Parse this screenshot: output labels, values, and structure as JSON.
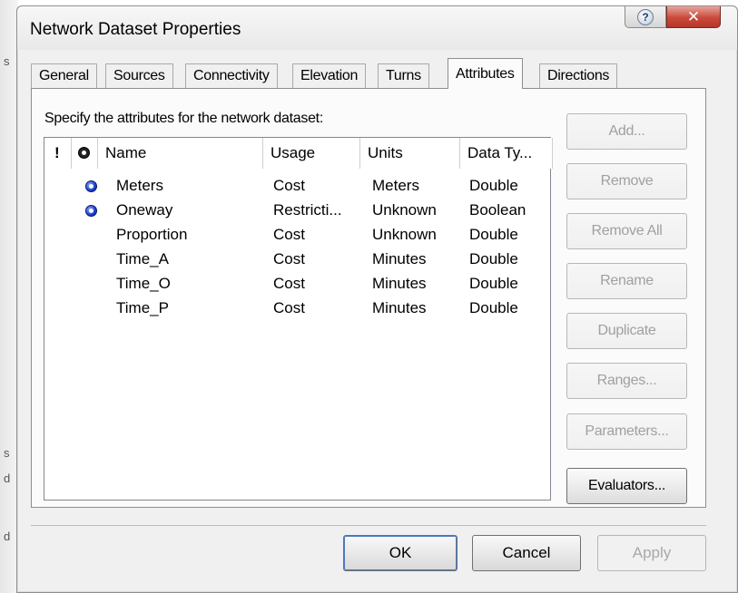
{
  "window": {
    "title": "Network Dataset Properties",
    "help_glyph": "?",
    "close_glyph": "✕"
  },
  "tabs": [
    {
      "label": "General",
      "active": false
    },
    {
      "label": "Sources",
      "active": false
    },
    {
      "label": "Connectivity",
      "active": false
    },
    {
      "label": "Elevation",
      "active": false
    },
    {
      "label": "Turns",
      "active": false
    },
    {
      "label": "Attributes",
      "active": true
    },
    {
      "label": "Directions",
      "active": false
    }
  ],
  "attributes_panel": {
    "instruction": "Specify the attributes for the network dataset:",
    "columns": {
      "required": "!",
      "default": "default-marker-icon",
      "name": "Name",
      "usage": "Usage",
      "units": "Units",
      "data_type": "Data Ty..."
    },
    "rows": [
      {
        "default": true,
        "name": "Meters",
        "usage": "Cost",
        "units": "Meters",
        "data_type": "Double"
      },
      {
        "default": true,
        "name": "Oneway",
        "usage": "Restricti...",
        "units": "Unknown",
        "data_type": "Boolean"
      },
      {
        "default": false,
        "name": "Proportion",
        "usage": "Cost",
        "units": "Unknown",
        "data_type": "Double"
      },
      {
        "default": false,
        "name": "Time_A",
        "usage": "Cost",
        "units": "Minutes",
        "data_type": "Double"
      },
      {
        "default": false,
        "name": "Time_O",
        "usage": "Cost",
        "units": "Minutes",
        "data_type": "Double"
      },
      {
        "default": false,
        "name": "Time_P",
        "usage": "Cost",
        "units": "Minutes",
        "data_type": "Double"
      }
    ],
    "buttons": {
      "add": "Add...",
      "remove": "Remove",
      "remove_all": "Remove All",
      "rename": "Rename",
      "duplicate": "Duplicate",
      "ranges": "Ranges...",
      "parameters": "Parameters...",
      "evaluators": "Evaluators..."
    }
  },
  "footer": {
    "ok": "OK",
    "cancel": "Cancel",
    "apply": "Apply"
  },
  "background_fragments": [
    "s",
    "s",
    "d",
    "d"
  ]
}
